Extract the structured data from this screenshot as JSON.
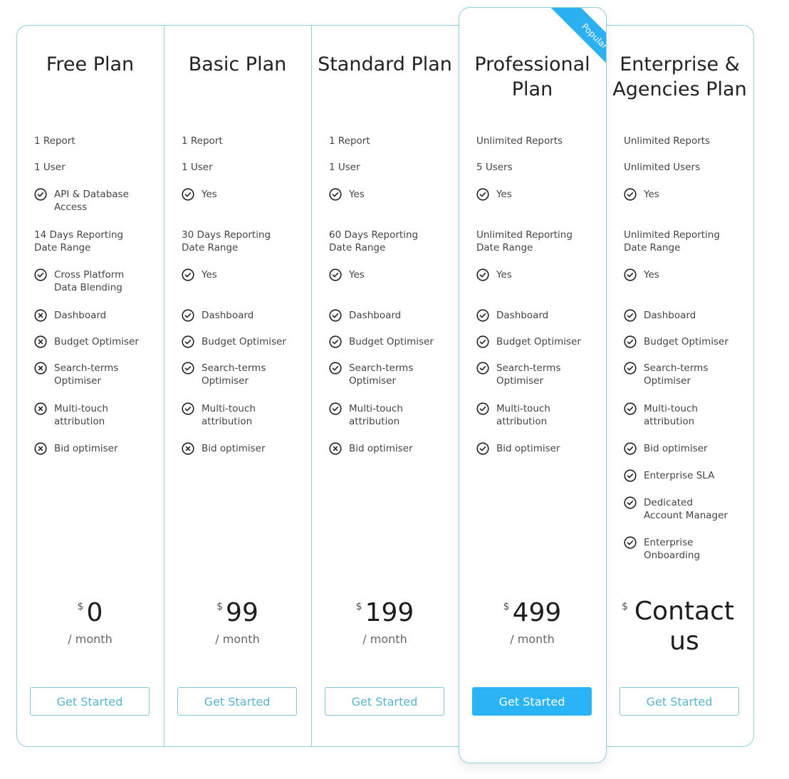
{
  "accent_color": "#2bb4f5",
  "border_color": "#8fd0de",
  "popular_badge": "Popular",
  "plans": [
    {
      "title": "Free Plan",
      "currency": "$",
      "price": "0",
      "period": "/  month",
      "button": "Get Started",
      "features": [
        {
          "icon": null,
          "text": "1 Report"
        },
        {
          "icon": null,
          "text": "1 User"
        },
        {
          "icon": "check",
          "text": "API & Database\nAccess"
        },
        {
          "icon": null,
          "text": "14 Days Reporting\nDate Range"
        },
        {
          "icon": "check",
          "text": "Cross Platform\nData Blending"
        },
        {
          "icon": "cross",
          "text": "Dashboard"
        },
        {
          "icon": "cross",
          "text": "Budget Optimiser"
        },
        {
          "icon": "cross",
          "text": "Search-terms\nOptimiser"
        },
        {
          "icon": "cross",
          "text": "Multi-touch\nattribution"
        },
        {
          "icon": "cross",
          "text": "Bid optimiser"
        }
      ]
    },
    {
      "title": "Basic Plan",
      "currency": "$",
      "price": "99",
      "period": "/  month",
      "button": "Get Started",
      "features": [
        {
          "icon": null,
          "text": "1 Report"
        },
        {
          "icon": null,
          "text": "1 User"
        },
        {
          "icon": "check",
          "text": "Yes"
        },
        {
          "icon": null,
          "text": "30 Days Reporting\nDate Range"
        },
        {
          "icon": "check",
          "text": "Yes"
        },
        {
          "icon": "check",
          "text": "Dashboard"
        },
        {
          "icon": "check",
          "text": "Budget Optimiser"
        },
        {
          "icon": "check",
          "text": "Search-terms\nOptimiser"
        },
        {
          "icon": "check",
          "text": "Multi-touch\nattribution"
        },
        {
          "icon": "cross",
          "text": "Bid optimiser"
        }
      ]
    },
    {
      "title": "Standard Plan",
      "currency": "$",
      "price": "199",
      "period": "/  month",
      "button": "Get Started",
      "features": [
        {
          "icon": null,
          "text": "1 Report"
        },
        {
          "icon": null,
          "text": "1 User"
        },
        {
          "icon": "check",
          "text": "Yes"
        },
        {
          "icon": null,
          "text": "60 Days Reporting\nDate Range"
        },
        {
          "icon": "check",
          "text": "Yes"
        },
        {
          "icon": "check",
          "text": "Dashboard"
        },
        {
          "icon": "check",
          "text": "Budget Optimiser"
        },
        {
          "icon": "check",
          "text": "Search-terms\nOptimiser"
        },
        {
          "icon": "check",
          "text": "Multi-touch\nattribution"
        },
        {
          "icon": "cross",
          "text": "Bid optimiser"
        }
      ]
    },
    {
      "title": "Professional\nPlan",
      "popular": true,
      "currency": "$",
      "price": "499",
      "period": "/  month",
      "button": "Get Started",
      "features": [
        {
          "icon": null,
          "text": "Unlimited Reports"
        },
        {
          "icon": null,
          "text": "5 Users"
        },
        {
          "icon": "check",
          "text": "Yes"
        },
        {
          "icon": null,
          "text": "Unlimited Reporting\nDate Range"
        },
        {
          "icon": "check",
          "text": "Yes"
        },
        {
          "icon": "check",
          "text": "Dashboard"
        },
        {
          "icon": "check",
          "text": "Budget Optimiser"
        },
        {
          "icon": "check",
          "text": "Search-terms\nOptimiser"
        },
        {
          "icon": "check",
          "text": "Multi-touch\nattribution"
        },
        {
          "icon": "check",
          "text": "Bid optimiser"
        }
      ]
    },
    {
      "title": "Enterprise &\nAgencies Plan",
      "currency": "$",
      "price": "Contact us",
      "period": null,
      "button": "Get Started",
      "features": [
        {
          "icon": null,
          "text": "Unlimited Reports"
        },
        {
          "icon": null,
          "text": "Unlimited Users"
        },
        {
          "icon": "check",
          "text": "Yes"
        },
        {
          "icon": null,
          "text": "Unlimited Reporting\nDate Range"
        },
        {
          "icon": "check",
          "text": "Yes"
        },
        {
          "icon": "check",
          "text": "Dashboard"
        },
        {
          "icon": "check",
          "text": "Budget Optimiser"
        },
        {
          "icon": "check",
          "text": "Search-terms\nOptimiser"
        },
        {
          "icon": "check",
          "text": "Multi-touch\nattribution"
        },
        {
          "icon": "check",
          "text": "Bid optimiser"
        },
        {
          "icon": "check",
          "text": "Enterprise SLA"
        },
        {
          "icon": "check",
          "text": "Dedicated\nAccount Manager"
        },
        {
          "icon": "check",
          "text": "Enterprise\nOnboarding"
        }
      ]
    }
  ]
}
